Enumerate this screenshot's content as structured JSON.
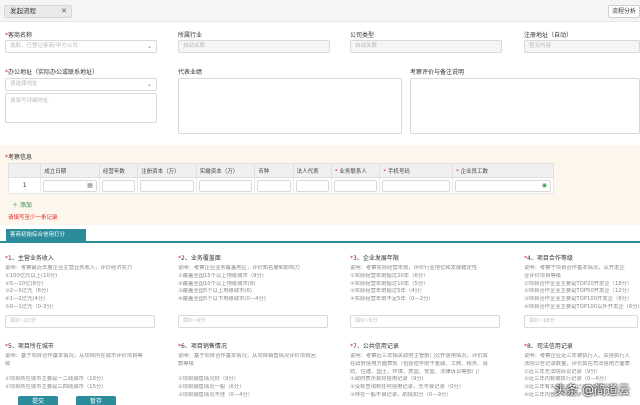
{
  "topbar": {
    "tab_label": "发起流程",
    "tab_close": "✕",
    "flow_label": "流程分析"
  },
  "form": {
    "customer_name": {
      "label": "客商名称",
      "placeholder": "选取，已登记客商/甲方公司"
    },
    "industry": {
      "label": "所属行业",
      "placeholder": "自动关联"
    },
    "company_type": {
      "label": "公司类型",
      "placeholder": "自动关联"
    },
    "reg_address": {
      "label": "注册地址（自动）",
      "placeholder": "暂无内容"
    },
    "office_address": {
      "label": "办公地址（实际办公或联系地址）",
      "select_placeholder": "请选择地址",
      "detail_placeholder": "请填写详细地址"
    },
    "rep_projects": {
      "label": "代表业绩"
    },
    "evaluation": {
      "label": "考察评价与备注说明"
    }
  },
  "inspection": {
    "title": "考察信息",
    "columns": [
      "成立日期",
      "经营年数",
      "注册资本（万）",
      "实缴资本（万）",
      "币种",
      "法人代表",
      "业务联系人",
      "手机号码",
      "企业员工数"
    ],
    "required_columns": [
      6,
      7,
      8
    ],
    "row_index": "1",
    "add_label": "添加",
    "warning": "请填写至少一条记录"
  },
  "scoring": {
    "tab_label": "客商初始综合信用打分",
    "sections": [
      {
        "title": "1、主营业务收入",
        "desc": [
          "说明：考察最近年度企业主营业务收入，评价经济实力",
          "①100亿元以上(10分)",
          "②5—10亿(8分)",
          "③2—5亿元（6分）",
          "④1—2亿元(4分)",
          "⑤0—1亿元（0-3分）"
        ],
        "placeholder": "如0~10分"
      },
      {
        "title": "2、业务覆盖面",
        "desc": [
          "说明：考察企业业务覆盖地区，评价知名度和影响力",
          "①覆盖全国15个以上地级城市（9分）",
          "②覆盖全国10个以上地级城市(8)",
          "③覆盖全国5个以上地级城市(6)",
          "④覆盖全国5个以下地级城市(0—4分)"
        ],
        "placeholder": "如0~9分"
      },
      {
        "title": "3、企业发展年限",
        "desc": [
          "说明：考察实际经营年限，评价行业地位和发展稳定性",
          "①实际经营年限超过20年（6分）",
          "②实际经营年限超过10年（5分）",
          "③实际经营年限超过5年（4分）",
          "④实际经营年限不足5年（0—2分）"
        ],
        "placeholder": "如0~6分"
      },
      {
        "title": "4、项目合作等级",
        "desc": [
          "说明：考察于项目合作基本情况，从开发企",
          "业评价项目等级",
          "①项目合作企业主要是TOP20开发企（18分）",
          "②项目合作企业主要是TOP50开发企（12分）",
          "③项目合作企业主要是TOP100开发企（8分）",
          "④项目合作企业主要是TOP100以外开发企（6分）"
        ],
        "placeholder": "如0~18分"
      },
      {
        "title": "5、项目所在城市",
        "desc": [
          "说明：基于项目合作基本情况，从项目所在城市评价项目等",
          "级",
          "",
          "①项目所在城市主要是一二线城市（18分）",
          "②项目所在城市主要是三四线城市（15分）"
        ],
        "placeholder": ""
      },
      {
        "title": "6、项目销售情况",
        "desc": [
          "说明：基于项目合作基本情况，从项目销售情况评价项目回",
          "款等级",
          "",
          "①项目销售情况好（9分）",
          "②项目销售情况一般（6分）",
          "③项目销售情况不佳（0—4分）"
        ],
        "placeholder": ""
      },
      {
        "title": "7、公共信用记录",
        "desc": [
          "说明：考察近三年相关政府主管部门公开信用情况，评价其",
          "在政府信用方面表现（包括但不限于金融、工商、税务、消",
          "防、住建、国土、环境、质监、安监、法律诉讼等部门）",
          "①政府表示良好信用记录（9分）",
          "②没有查询到任何信用记录，无不良记录（0分）",
          "③存在一般不良记录，酌情扣分（0—9分）"
        ],
        "placeholder": ""
      },
      {
        "title": "8、司法信用记录",
        "desc": [
          "说明：考察企业近三年被执行人、失信执行人",
          "法院公告记录数量，评价其在司法信用方面表",
          "①近三年无法院诉讼记录（9分）",
          "②近三年内有被执行记录（0—6分）",
          "③近三年有失信执行人记录（0分）",
          "④近三年内曾无不良记录（3分）"
        ],
        "placeholder": ""
      }
    ]
  },
  "buttons": {
    "submit": "提交",
    "save": "暂存"
  },
  "watermark": "头条 @简道云",
  "colors": {
    "primary": "#2c8c9c",
    "required": "#e02020",
    "add": "#2a8a4a"
  },
  "icons": {
    "select": "chevron-down-icon",
    "date": "calendar-icon",
    "number": "radio-icon"
  }
}
